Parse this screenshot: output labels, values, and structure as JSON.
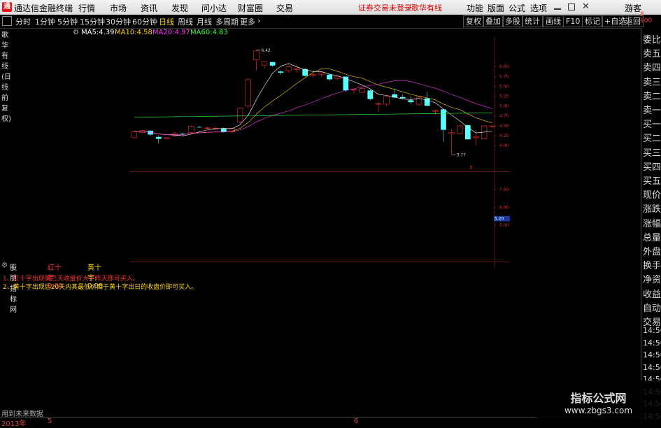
{
  "app": {
    "title": "通达信金融终端",
    "menus": [
      "行情",
      "市场",
      "资讯",
      "发现",
      "问小达",
      "财富圈",
      "交易"
    ],
    "warning": "证券交易未登录",
    "stock_name": "歌华有线",
    "right_menus": [
      "功能",
      "版面",
      "公式",
      "选项"
    ],
    "guest": "游客"
  },
  "toolbar": {
    "periods": [
      "分时",
      "1分钟",
      "5分钟",
      "15分钟",
      "30分钟",
      "60分钟",
      "日线",
      "周线",
      "月线",
      "多周期",
      "更多"
    ],
    "active": "日线",
    "buttons": [
      "复权",
      "叠加",
      "多股",
      "统计",
      "画线",
      "F10",
      "标记",
      "+自选",
      "返回"
    ]
  },
  "info": {
    "title": "歌华有线(日线 前复权)",
    "ma": [
      {
        "label": "MA5:",
        "value": "4.39",
        "color": "#ffffff"
      },
      {
        "label": "MA10:",
        "value": "4.58",
        "color": "#ffd700"
      },
      {
        "label": "MA20:",
        "value": "4.97",
        "color": "#ff33ff"
      },
      {
        "label": "MA60:",
        "value": "4.83",
        "color": "#33ff33"
      }
    ]
  },
  "price_labels": [
    "6.00",
    "5.75",
    "5.50",
    "5.25",
    "5.00",
    "4.75",
    "4.50",
    "4.25",
    "4.00"
  ],
  "annotations": {
    "high": "6.42",
    "low": "3.77",
    "current": "5.20"
  },
  "chart_data": {
    "type": "candlestick",
    "candles": [
      {
        "o": 4.2,
        "h": 4.37,
        "l": 4.18,
        "c": 4.35
      },
      {
        "o": 4.33,
        "h": 4.4,
        "l": 4.3,
        "c": 4.38
      },
      {
        "o": 4.38,
        "h": 4.38,
        "l": 4.25,
        "c": 4.28
      },
      {
        "o": 4.22,
        "h": 4.25,
        "l": 4.05,
        "c": 4.17
      },
      {
        "o": 4.18,
        "h": 4.2,
        "l": 4.15,
        "c": 4.2
      },
      {
        "o": 4.25,
        "h": 4.35,
        "l": 4.22,
        "c": 4.31
      },
      {
        "o": 4.3,
        "h": 4.33,
        "l": 4.25,
        "c": 4.28
      },
      {
        "o": 4.33,
        "h": 4.52,
        "l": 4.3,
        "c": 4.49
      },
      {
        "o": 4.47,
        "h": 4.5,
        "l": 4.45,
        "c": 4.46
      },
      {
        "o": 4.45,
        "h": 4.48,
        "l": 4.42,
        "c": 4.45
      },
      {
        "o": 4.44,
        "h": 4.48,
        "l": 4.41,
        "c": 4.44
      },
      {
        "o": 4.44,
        "h": 4.46,
        "l": 4.33,
        "c": 4.35
      },
      {
        "o": 4.35,
        "h": 4.45,
        "l": 4.33,
        "c": 4.44
      },
      {
        "o": 4.6,
        "h": 4.97,
        "l": 4.55,
        "c": 4.95
      },
      {
        "o": 5.0,
        "h": 5.72,
        "l": 4.95,
        "c": 5.67
      },
      {
        "o": 6.18,
        "h": 6.42,
        "l": 5.9,
        "c": 6.4
      },
      {
        "o": 6.04,
        "h": 6.14,
        "l": 5.95,
        "c": 6.13
      },
      {
        "o": 6.12,
        "h": 6.12,
        "l": 6.0,
        "c": 6.03
      },
      {
        "o": 5.88,
        "h": 5.91,
        "l": 5.8,
        "c": 5.85
      },
      {
        "o": 5.9,
        "h": 6.05,
        "l": 5.85,
        "c": 6.0
      },
      {
        "o": 5.93,
        "h": 6.05,
        "l": 5.85,
        "c": 5.97
      },
      {
        "o": 5.94,
        "h": 5.97,
        "l": 5.75,
        "c": 5.77
      },
      {
        "o": 5.78,
        "h": 5.83,
        "l": 5.74,
        "c": 5.8
      },
      {
        "o": 5.81,
        "h": 5.86,
        "l": 5.75,
        "c": 5.85
      },
      {
        "o": 5.8,
        "h": 5.82,
        "l": 5.64,
        "c": 5.68
      },
      {
        "o": 5.7,
        "h": 5.78,
        "l": 5.66,
        "c": 5.75
      },
      {
        "o": 5.75,
        "h": 5.75,
        "l": 5.37,
        "c": 5.4
      },
      {
        "o": 5.42,
        "h": 5.45,
        "l": 5.32,
        "c": 5.42
      },
      {
        "o": 5.35,
        "h": 5.55,
        "l": 5.34,
        "c": 5.45
      },
      {
        "o": 5.4,
        "h": 5.42,
        "l": 5.15,
        "c": 5.18
      },
      {
        "o": 5.05,
        "h": 5.13,
        "l": 4.85,
        "c": 5.06
      },
      {
        "o": 5.05,
        "h": 5.28,
        "l": 5.0,
        "c": 5.25
      },
      {
        "o": 5.3,
        "h": 5.45,
        "l": 5.2,
        "c": 5.22
      },
      {
        "o": 5.23,
        "h": 5.3,
        "l": 5.18,
        "c": 5.2
      },
      {
        "o": 5.15,
        "h": 5.25,
        "l": 5.05,
        "c": 5.1
      },
      {
        "o": 5.05,
        "h": 5.27,
        "l": 5.0,
        "c": 5.23
      },
      {
        "o": 5.2,
        "h": 5.37,
        "l": 5.0,
        "c": 5.01
      },
      {
        "o": 4.87,
        "h": 4.92,
        "l": 4.78,
        "c": 4.9
      },
      {
        "o": 4.92,
        "h": 4.92,
        "l": 4.1,
        "c": 4.4
      },
      {
        "o": 4.3,
        "h": 4.42,
        "l": 3.77,
        "c": 4.33
      },
      {
        "o": 4.3,
        "h": 4.52,
        "l": 4.28,
        "c": 4.5
      },
      {
        "o": 4.52,
        "h": 4.52,
        "l": 4.15,
        "c": 4.16
      },
      {
        "o": 4.2,
        "h": 4.38,
        "l": 4.0,
        "c": 4.22
      },
      {
        "o": 4.17,
        "h": 4.52,
        "l": 4.15,
        "c": 4.5
      },
      {
        "o": 4.48,
        "h": 4.52,
        "l": 4.45,
        "c": 4.5
      }
    ],
    "ylim": [
      3.7,
      6.5
    ],
    "high_label": "6.42",
    "low_label": "3.77"
  },
  "sub": {
    "name": "股朋指标网",
    "red_label": "红十字: 0.00",
    "yellow_label": "黄十字: 0.00",
    "notes": [
      "1、红十字出现第二天收盘价大于昨天即可买入。",
      "2、黄十字出现后20天内其最低价高于黄十字出日的收盘价即可买入。"
    ],
    "y_labels": [
      "7.00",
      "6.00",
      "5.00"
    ]
  },
  "right_panel": {
    "items": [
      "委比",
      "卖五",
      "卖四",
      "卖三",
      "卖二",
      "卖一",
      "买一",
      "买二",
      "买三",
      "买四",
      "买五",
      "现价",
      "涨跌",
      "涨幅",
      "总量",
      "外盘",
      "换手",
      "净资",
      "收益",
      "自动",
      "交易"
    ],
    "times": [
      "14:56",
      "14:56",
      "14:56",
      "14:56",
      "14:56",
      "14:56",
      "14:56",
      "14:56"
    ]
  },
  "bottom": {
    "text": "用到未来数据",
    "year": "2013年",
    "m5": "5",
    "m6": "6"
  },
  "watermark": {
    "line1": "指标公式网",
    "line2": "www.zbgs3.com"
  }
}
